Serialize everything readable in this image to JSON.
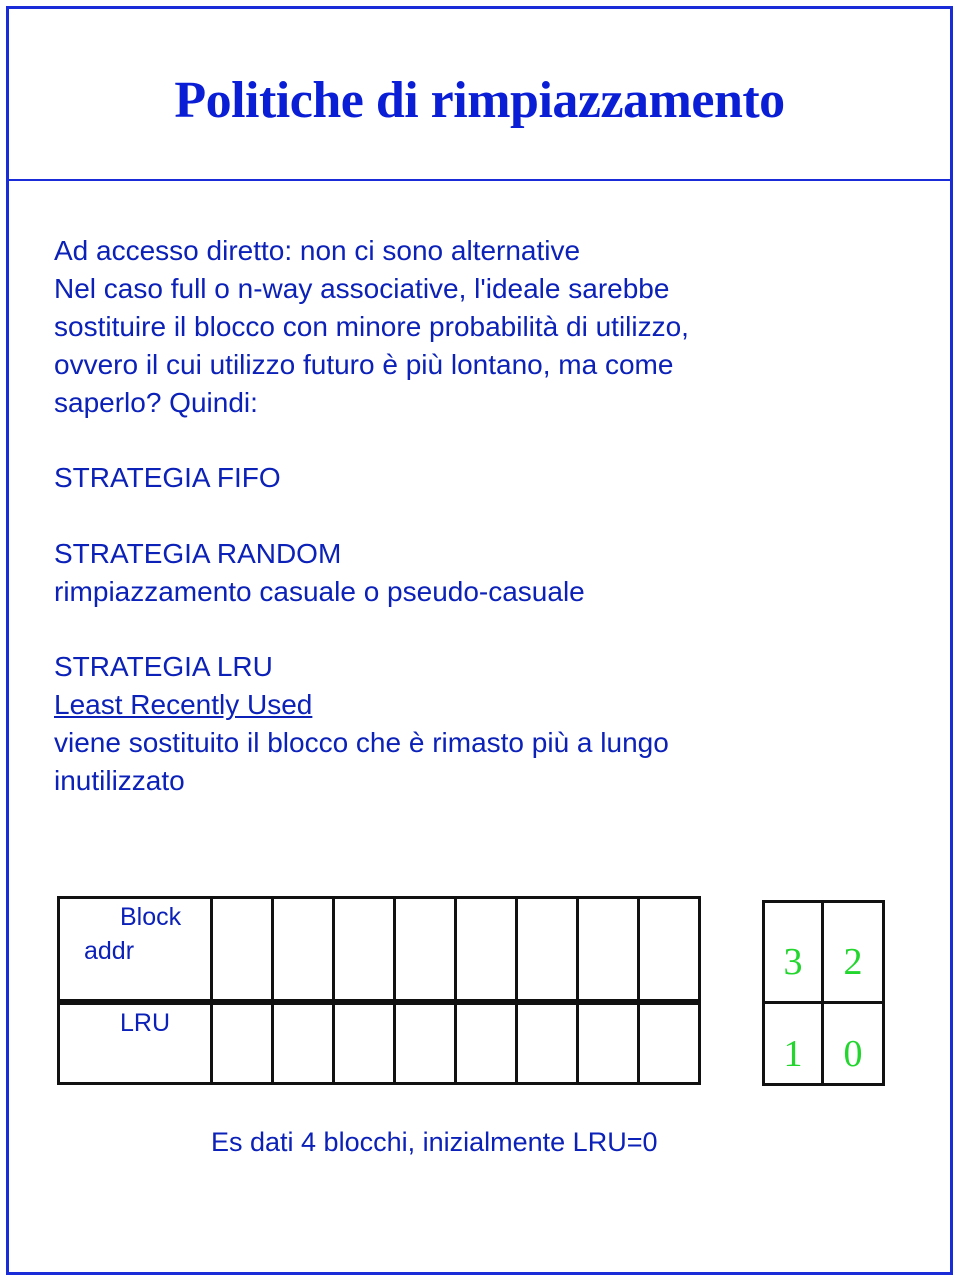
{
  "slide": {
    "title": "Politiche di rimpiazzamento",
    "intro_lines": [
      "Ad accesso diretto: non ci sono alternative",
      "Nel caso full o n-way associative, l'ideale sarebbe",
      "sostituire il blocco con minore probabilità di utilizzo,",
      "ovvero il cui utilizzo futuro è più lontano, ma come",
      "saperlo? Quindi:"
    ],
    "fifo": "STRATEGIA FIFO",
    "random": {
      "heading": "STRATEGIA RANDOM",
      "desc": "rimpiazzamento casuale o pseudo-casuale"
    },
    "lru": {
      "heading": "STRATEGIA LRU",
      "subtitle": "Least Recently Used",
      "desc_lines": [
        "viene sostituito il blocco che è rimasto più a lungo",
        "inutilizzato"
      ]
    },
    "table": {
      "row1_label_a": "Block",
      "row1_label_b": "addr",
      "row2_label": "LRU",
      "values": [
        "3",
        "2",
        "1",
        "0"
      ]
    },
    "caption": "Es dati 4 blocchi, inizialmente LRU=0"
  }
}
